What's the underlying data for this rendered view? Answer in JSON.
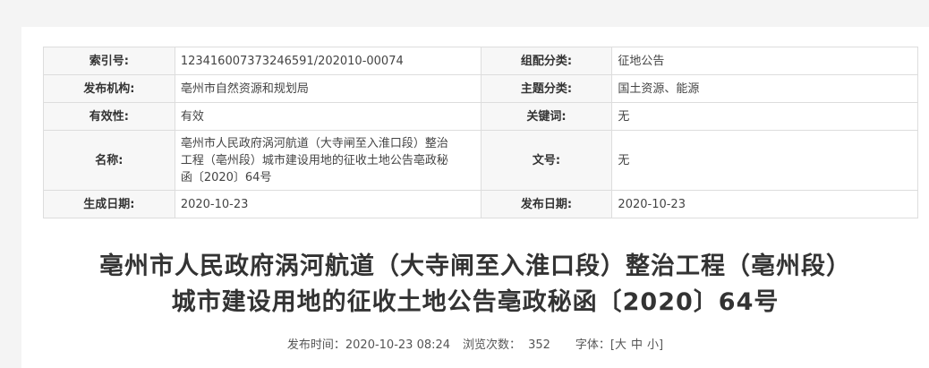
{
  "meta": {
    "index_label": "索引号:",
    "index_value": "123416007373246591/202010-00074",
    "category_label": "组配分类:",
    "category_value": "征地公告",
    "publisher_label": "发布机构:",
    "publisher_value": "亳州市自然资源和规划局",
    "topic_label": "主题分类:",
    "topic_value": "国土资源、能源",
    "validity_label": "有效性:",
    "validity_value": "有效",
    "keywords_label": "关键词:",
    "keywords_value": "无",
    "name_label": "名称:",
    "name_value_line1": "亳州市人民政府涡河航道（大寺闸至入淮口段）整治",
    "name_value_line2": "工程（亳州段）城市建设用地的征收土地公告亳政秘",
    "name_value_line3": "函〔2020〕64号",
    "docno_label": "文号:",
    "docno_value": "无",
    "created_label": "生成日期:",
    "created_value": "2020-10-23",
    "published_label": "发布日期:",
    "published_value": "2020-10-23"
  },
  "article": {
    "title_line1": "亳州市人民政府涡河航道（大寺闸至入淮口段）整治工程（亳州段）",
    "title_line2": "城市建设用地的征收土地公告亳政秘函〔2020〕64号",
    "time_label": "发布时间：",
    "time_value": "2020-10-23 08:24",
    "views_label": "浏览次数：",
    "views_value": "352",
    "font_label": "字体：",
    "font_open": "[",
    "font_large": "大",
    "font_medium": "中",
    "font_small": "小",
    "font_close": "]"
  }
}
